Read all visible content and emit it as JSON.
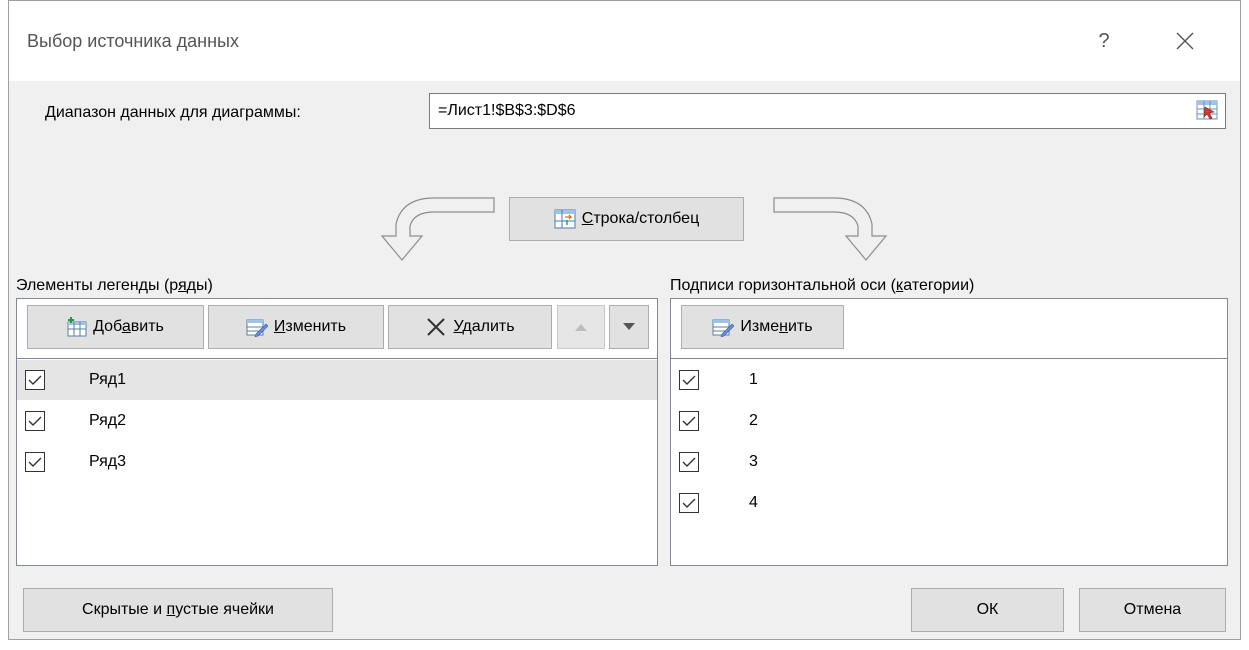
{
  "dialog": {
    "title": "Выбор источника данных",
    "help_label": "?"
  },
  "range": {
    "label_underlined": "Д",
    "label_rest": "иапазон данных для диаграммы:",
    "value": "=Лист1!$B$3:$D$6"
  },
  "switch_button": {
    "pre": "",
    "underlined": "С",
    "post": "трока/столбец"
  },
  "legend": {
    "label_pre": "Элементы легенды (р",
    "label_underlined": "я",
    "label_post": "ды)",
    "add": {
      "pre": "Доб",
      "underlined": "а",
      "post": "вить"
    },
    "edit": {
      "pre": "",
      "underlined": "И",
      "post": "зменить"
    },
    "remove": {
      "pre": "",
      "underlined": "У",
      "post": "далить"
    },
    "items": [
      {
        "label": "Ряд1",
        "checked": true,
        "selected": true
      },
      {
        "label": "Ряд2",
        "checked": true,
        "selected": false
      },
      {
        "label": "Ряд3",
        "checked": true,
        "selected": false
      }
    ]
  },
  "axis": {
    "label_pre": "Подписи горизонтальной оси (",
    "label_underlined": "к",
    "label_post": "атегории)",
    "edit": {
      "pre": "Изме",
      "underlined": "н",
      "post": "ить"
    },
    "items": [
      {
        "label": "1",
        "checked": true
      },
      {
        "label": "2",
        "checked": true
      },
      {
        "label": "3",
        "checked": true
      },
      {
        "label": "4",
        "checked": true
      }
    ]
  },
  "footer": {
    "hidden_cells": {
      "pre": "Скрытые и ",
      "underlined": "п",
      "post": "устые ячейки"
    },
    "ok": "ОК",
    "cancel": "Отмена"
  },
  "colors": {
    "dialog_bg": "#f0f0f0",
    "button_bg": "#e1e1e1",
    "selected_row": "#e5e5e5"
  }
}
